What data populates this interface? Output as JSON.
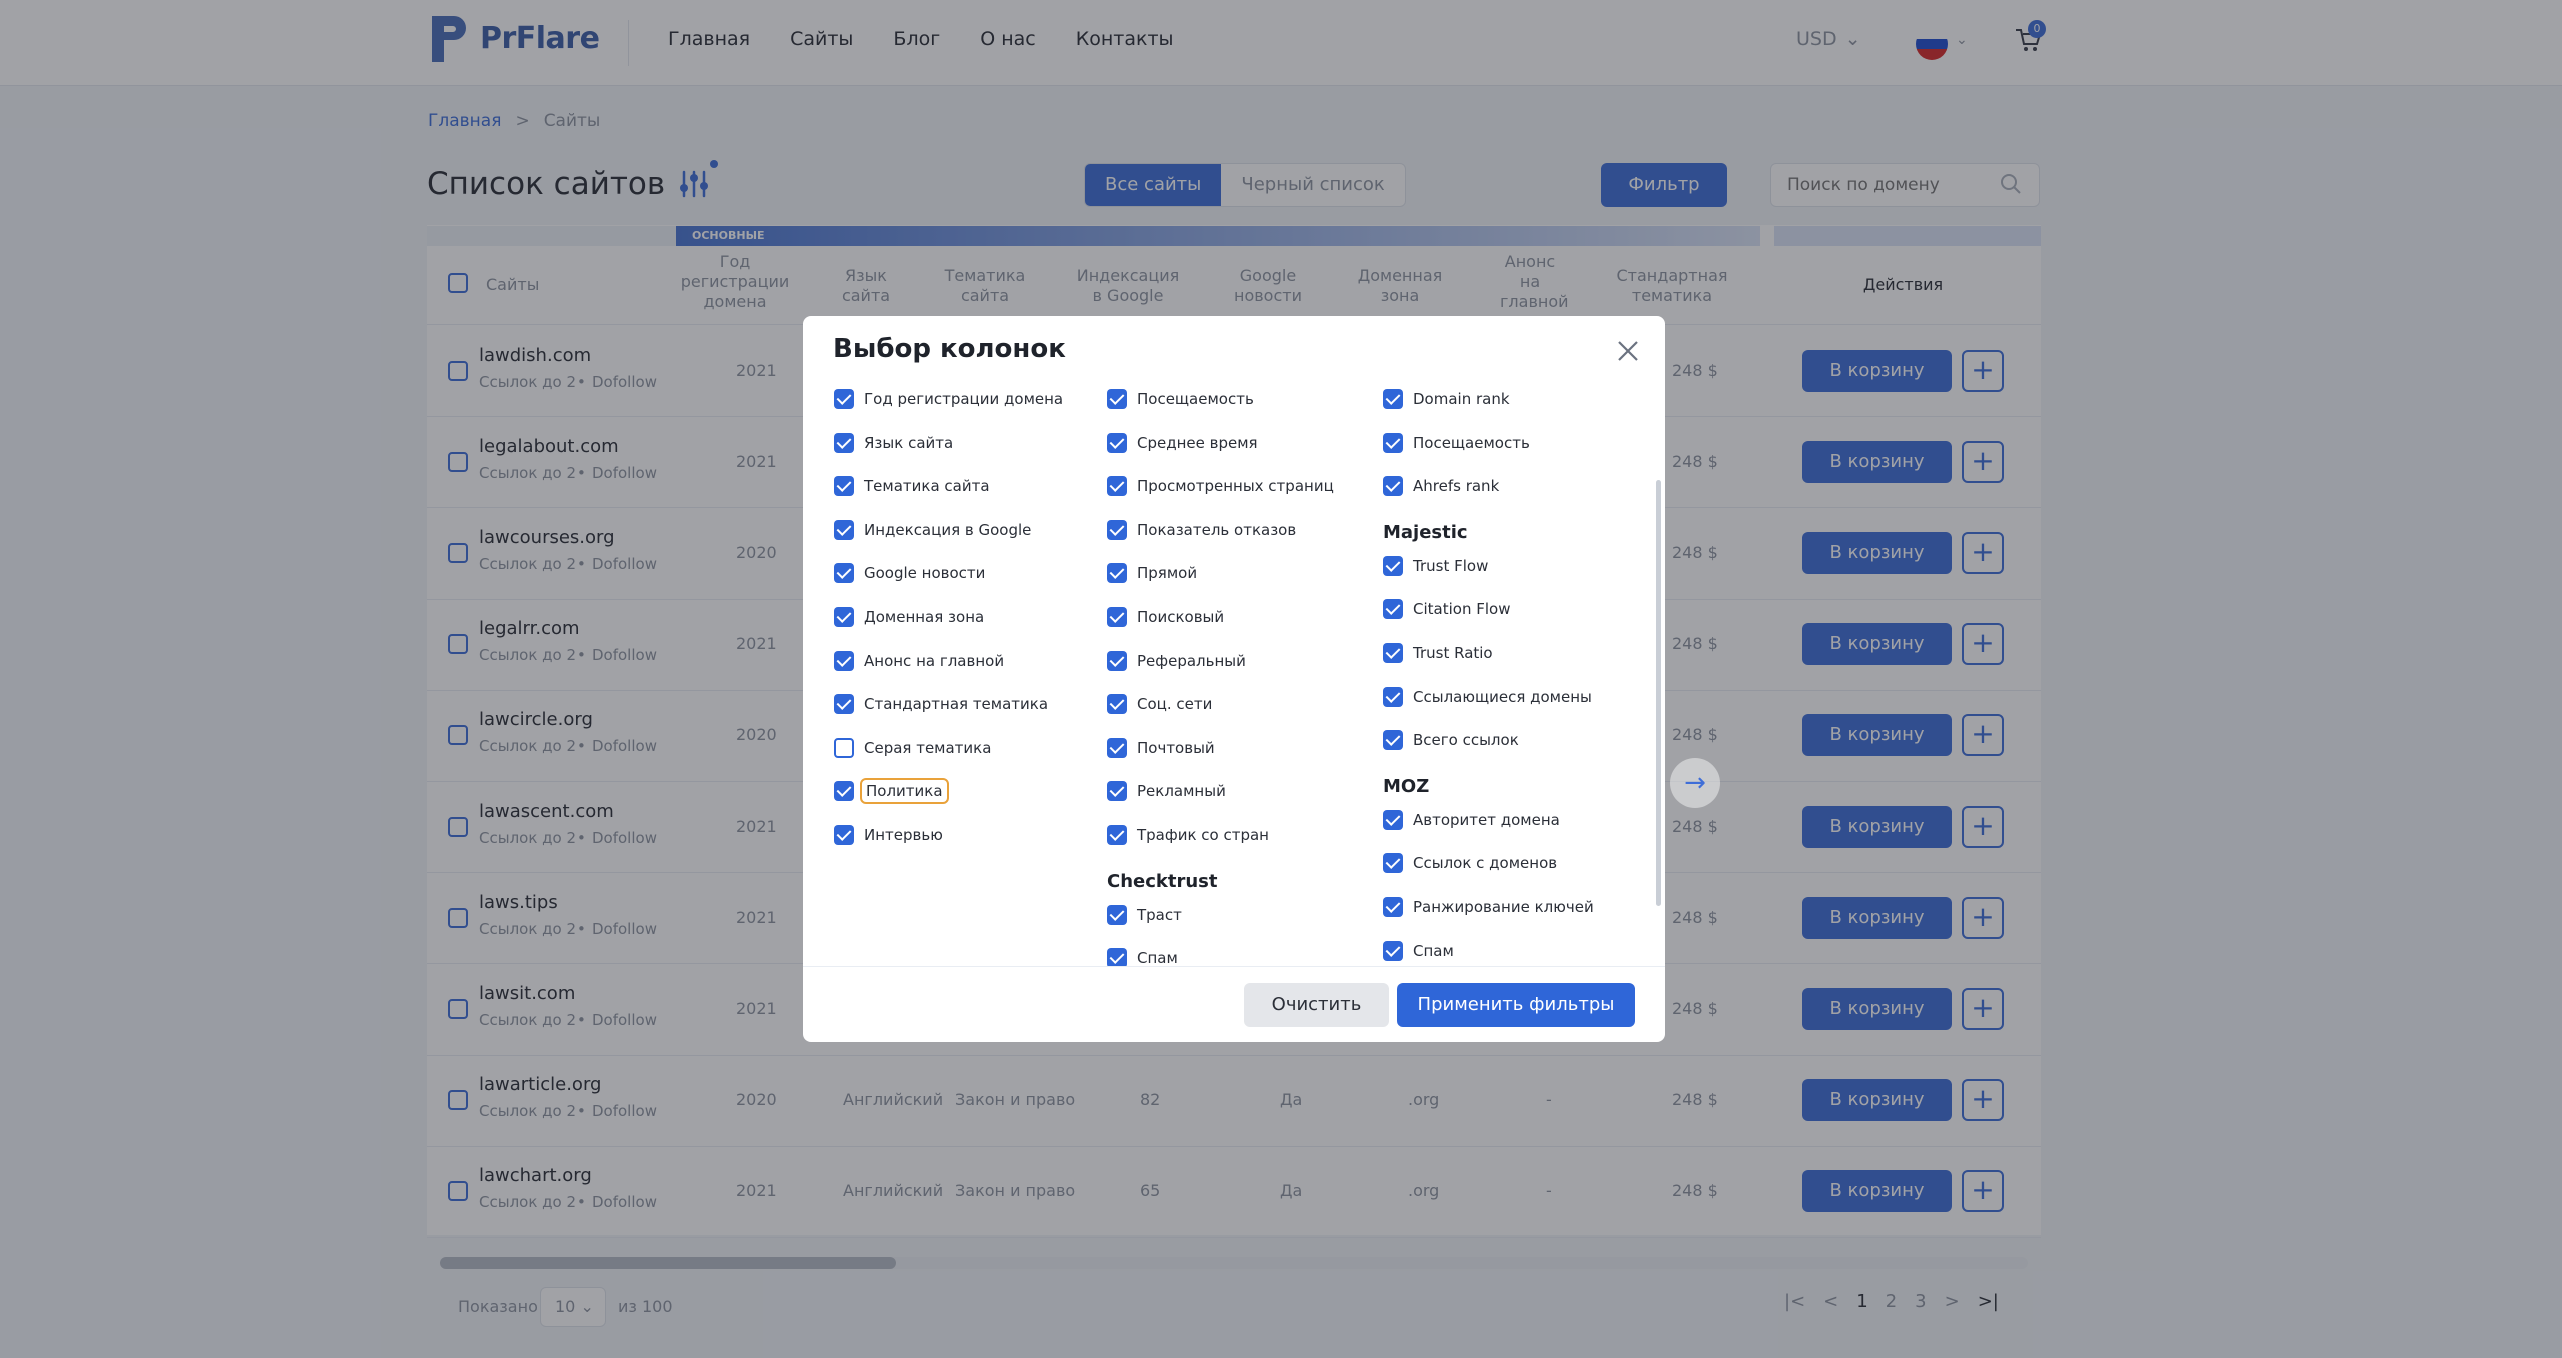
{
  "header": {
    "logo_text": "PrFlare",
    "nav": [
      "Главная",
      "Сайты",
      "Блог",
      "О нас",
      "Контакты"
    ],
    "currency": "USD",
    "cart_count": "0",
    "flag_colors": [
      "#ffffff",
      "#1f4fd0",
      "#d62a2a"
    ]
  },
  "breadcrumb": {
    "home": "Главная",
    "separator": ">",
    "current": "Сайты"
  },
  "page": {
    "title": "Список сайтов",
    "tabs": [
      "Все сайты",
      "Черный список"
    ],
    "filter_button": "Фильтр",
    "search_placeholder": "Поиск по домену"
  },
  "table": {
    "group_label": "ОСНОВНЫЕ",
    "headers": [
      "Сайты",
      "Год регистрации домена",
      "Язык сайта",
      "Тематика сайта",
      "Индексация в Google",
      "Google новости",
      "Доменная зона",
      "Анонс на главной",
      "Стандартная тематика",
      "Действия"
    ],
    "rows": [
      {
        "site": "lawdish.com",
        "sub1": "Ссылок до 2",
        "sub2": "Dofollow",
        "year": "2021",
        "price": "248 $"
      },
      {
        "site": "legalabout.com",
        "sub1": "Ссылок до 2",
        "sub2": "Dofollow",
        "year": "2021",
        "price": "248 $"
      },
      {
        "site": "lawcourses.org",
        "sub1": "Ссылок до 2",
        "sub2": "Dofollow",
        "year": "2020",
        "price": "248 $"
      },
      {
        "site": "legalrr.com",
        "sub1": "Ссылок до 2",
        "sub2": "Dofollow",
        "year": "2021",
        "price": "248 $"
      },
      {
        "site": "lawcircle.org",
        "sub1": "Ссылок до 2",
        "sub2": "Dofollow",
        "year": "2020",
        "price": "248 $"
      },
      {
        "site": "lawascent.com",
        "sub1": "Ссылок до 2",
        "sub2": "Dofollow",
        "year": "2021",
        "price": "248 $"
      },
      {
        "site": "laws.tips",
        "sub1": "Ссылок до 2",
        "sub2": "Dofollow",
        "year": "2021",
        "price": "248 $"
      },
      {
        "site": "lawsit.com",
        "sub1": "Ссылок до 2",
        "sub2": "Dofollow",
        "year": "2021",
        "price": "248 $"
      },
      {
        "site": "lawarticle.org",
        "sub1": "Ссылок до 2",
        "sub2": "Dofollow",
        "year": "2020",
        "lang": "Английский",
        "theme": "Закон и право",
        "index": "82",
        "news": "Да",
        "zone": ".org",
        "announce": "-",
        "price": "248 $"
      },
      {
        "site": "lawchart.org",
        "sub1": "Ссылок до 2",
        "sub2": "Dofollow",
        "year": "2021",
        "lang": "Английский",
        "theme": "Закон и право",
        "index": "65",
        "news": "Да",
        "zone": ".org",
        "announce": "-",
        "price": "248 $"
      }
    ],
    "cart_button": "В корзину",
    "plus_button": "+"
  },
  "pagination": {
    "shown_label": "Показано",
    "per_page": "10",
    "of_label": "из 100",
    "pages": [
      "1",
      "2",
      "3"
    ]
  },
  "modal": {
    "title": "Выбор колонок",
    "col1": [
      {
        "label": "Год регистрации домена",
        "checked": true
      },
      {
        "label": "Язык сайта",
        "checked": true
      },
      {
        "label": "Тематика сайта",
        "checked": true
      },
      {
        "label": "Индексация в Google",
        "checked": true
      },
      {
        "label": "Google новости",
        "checked": true
      },
      {
        "label": "Доменная зона",
        "checked": true
      },
      {
        "label": "Анонс на главной",
        "checked": true
      },
      {
        "label": "Стандартная тематика",
        "checked": true
      },
      {
        "label": "Серая тематика",
        "checked": false
      },
      {
        "label": "Политика",
        "checked": true
      },
      {
        "label": "Интервью",
        "checked": true
      }
    ],
    "col2": [
      {
        "label": "Посещаемость",
        "checked": true
      },
      {
        "label": "Среднее время",
        "checked": true
      },
      {
        "label": "Просмотренных страниц",
        "checked": true
      },
      {
        "label": "Показатель отказов",
        "checked": true
      },
      {
        "label": "Прямой",
        "checked": true
      },
      {
        "label": "Поисковый",
        "checked": true
      },
      {
        "label": "Реферальный",
        "checked": true
      },
      {
        "label": "Соц. сети",
        "checked": true
      },
      {
        "label": "Почтовый",
        "checked": true
      },
      {
        "label": "Рекламный",
        "checked": true
      },
      {
        "label": "Трафик со стран",
        "checked": true
      }
    ],
    "checktrust_title": "Checktrust",
    "checktrust": [
      {
        "label": "Траст",
        "checked": true
      },
      {
        "label": "Спам",
        "checked": true
      }
    ],
    "col3": [
      {
        "label": "Domain rank",
        "checked": true
      },
      {
        "label": "Посещаемость",
        "checked": true
      },
      {
        "label": "Ahrefs rank",
        "checked": true
      }
    ],
    "majestic_title": "Majestic",
    "majestic": [
      {
        "label": "Trust Flow",
        "checked": true
      },
      {
        "label": "Citation Flow",
        "checked": true
      },
      {
        "label": "Trust Ratio",
        "checked": true
      },
      {
        "label": "Ссылающиеся домены",
        "checked": true
      },
      {
        "label": "Всего ссылок",
        "checked": true
      }
    ],
    "moz_title": "MOZ",
    "moz": [
      {
        "label": "Авторитет домена",
        "checked": true
      },
      {
        "label": "Ссылок с доменов",
        "checked": true
      },
      {
        "label": "Ранжирование ключей",
        "checked": true
      },
      {
        "label": "Спам",
        "checked": true
      }
    ],
    "clear_button": "Очистить",
    "apply_button": "Применить фильтры"
  }
}
